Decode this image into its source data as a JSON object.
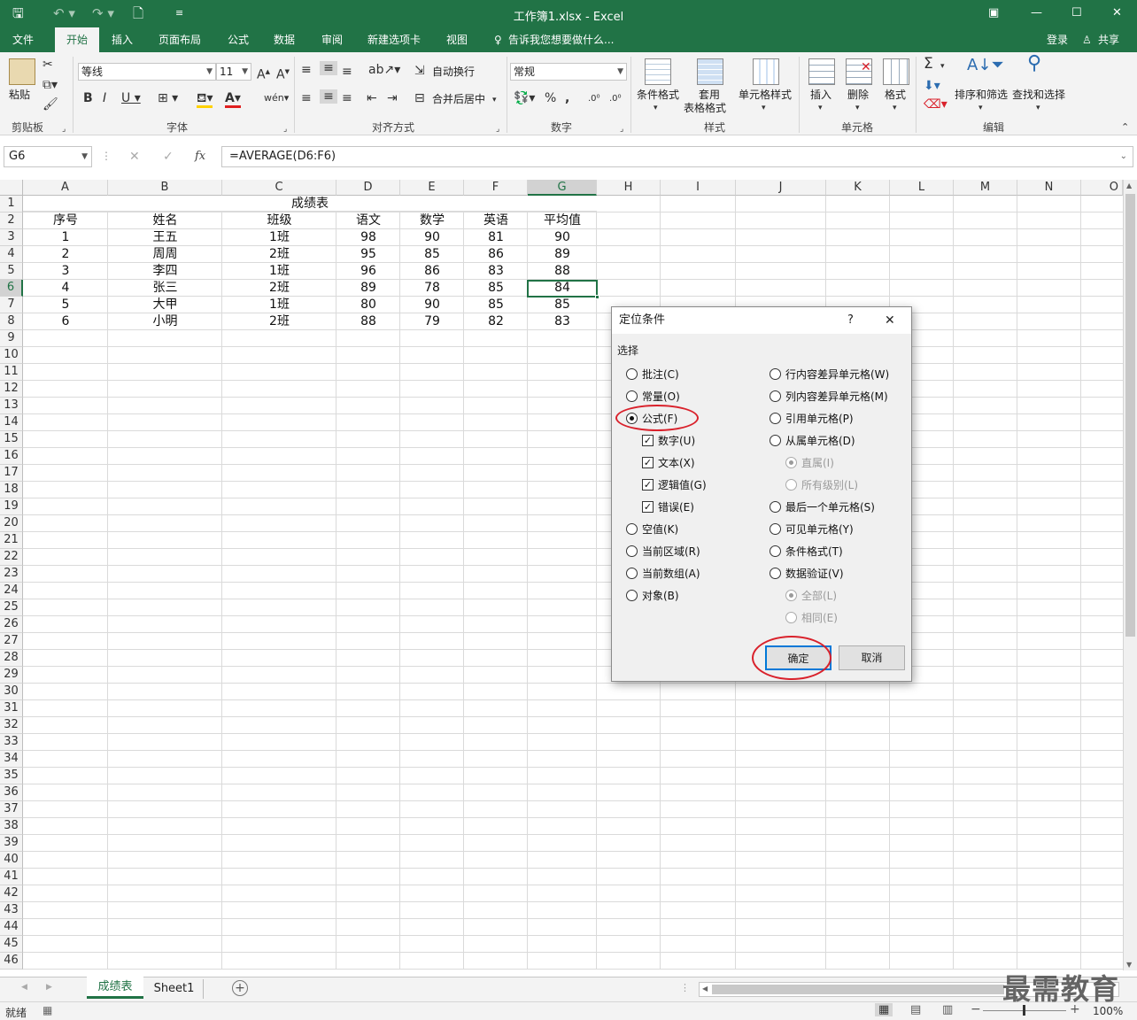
{
  "window": {
    "title": "工作簿1.xlsx - Excel",
    "login": "登录",
    "share": "共享"
  },
  "tabs": [
    "文件",
    "开始",
    "插入",
    "页面布局",
    "公式",
    "数据",
    "审阅",
    "新建选项卡",
    "视图"
  ],
  "tell_me": "告诉我您想要做什么...",
  "ribbon": {
    "paste": "粘贴",
    "font_name": "等线",
    "font_size": "11",
    "autowrap": "自动换行",
    "merge_center": "合并后居中",
    "number_format": "常规",
    "cond_format": "条件格式",
    "table_format_1": "套用",
    "table_format_2": "表格格式",
    "cell_styles": "单元格样式",
    "insert": "插入",
    "delete": "删除",
    "format": "格式",
    "sort_filter": "排序和筛选",
    "find_select": "查找和选择",
    "groups": {
      "clipboard": "剪贴板",
      "font": "字体",
      "alignment": "对齐方式",
      "number": "数字",
      "styles": "样式",
      "cells": "单元格",
      "editing": "编辑"
    }
  },
  "formula_bar": {
    "namebox": "G6",
    "formula": "=AVERAGE(D6:F6)",
    "fx": "fx"
  },
  "columns": [
    "A",
    "B",
    "C",
    "D",
    "E",
    "F",
    "G",
    "H",
    "I",
    "J",
    "K",
    "L",
    "M",
    "N",
    "O"
  ],
  "rows": [
    "1",
    "2",
    "3",
    "4",
    "5",
    "6",
    "7",
    "8",
    "9",
    "10",
    "11",
    "12",
    "13",
    "14",
    "15",
    "16",
    "17",
    "18",
    "19",
    "20",
    "21",
    "22",
    "23",
    "24",
    "25",
    "26",
    "27",
    "28",
    "29",
    "30",
    "31",
    "32",
    "33",
    "34",
    "35",
    "36",
    "37",
    "38",
    "39",
    "40",
    "41",
    "42",
    "43",
    "44",
    "45",
    "46"
  ],
  "sheet": {
    "title": "成绩表",
    "headers": [
      "序号",
      "姓名",
      "班级",
      "语文",
      "数学",
      "英语",
      "平均值"
    ],
    "data": [
      [
        "1",
        "王五",
        "1班",
        "98",
        "90",
        "81",
        "90"
      ],
      [
        "2",
        "周周",
        "2班",
        "95",
        "85",
        "86",
        "89"
      ],
      [
        "3",
        "李四",
        "1班",
        "96",
        "86",
        "83",
        "88"
      ],
      [
        "4",
        "张三",
        "2班",
        "89",
        "78",
        "85",
        "84"
      ],
      [
        "5",
        "大甲",
        "1班",
        "80",
        "90",
        "85",
        "85"
      ],
      [
        "6",
        "小明",
        "2班",
        "88",
        "79",
        "82",
        "83"
      ]
    ]
  },
  "sheet_tabs": [
    "成绩表",
    "Sheet1"
  ],
  "status": {
    "ready": "就绪",
    "zoom": "100%"
  },
  "watermark": "最需教育",
  "dialog": {
    "title": "定位条件",
    "help": "?",
    "close": "✕",
    "section": "选择",
    "left": [
      "批注(C)",
      "常量(O)",
      "公式(F)",
      "数字(U)",
      "文本(X)",
      "逻辑值(G)",
      "错误(E)",
      "空值(K)",
      "当前区域(R)",
      "当前数组(A)",
      "对象(B)"
    ],
    "right": [
      "行内容差异单元格(W)",
      "列内容差异单元格(M)",
      "引用单元格(P)",
      "从属单元格(D)",
      "直属(I)",
      "所有级别(L)",
      "最后一个单元格(S)",
      "可见单元格(Y)",
      "条件格式(T)",
      "数据验证(V)",
      "全部(L)",
      "相同(E)"
    ],
    "ok": "确定",
    "cancel": "取消"
  }
}
